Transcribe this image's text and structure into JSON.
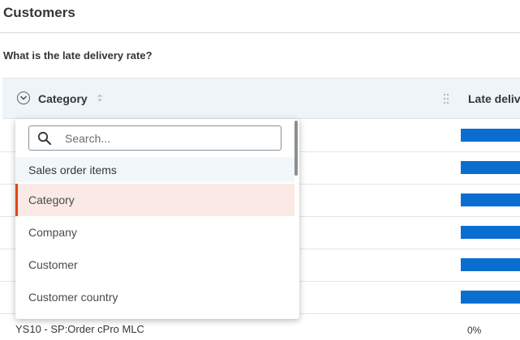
{
  "page": {
    "title": "Customers",
    "question": "What is the late delivery rate?"
  },
  "table": {
    "columns": [
      {
        "label": "Category"
      },
      {
        "label": "Late delivery rate"
      }
    ],
    "visible_row": {
      "category": "YS10 - SP:Order cPro MLC",
      "value": "0%"
    }
  },
  "dropdown": {
    "search_placeholder": "Search...",
    "group_label": "Sales order items",
    "options": [
      {
        "label": "Category",
        "selected": true
      },
      {
        "label": "Company",
        "selected": false
      },
      {
        "label": "Customer",
        "selected": false
      },
      {
        "label": "Customer country",
        "selected": false
      }
    ]
  },
  "colors": {
    "bar": "#0a6ed1",
    "selected_accent": "#e0441a",
    "selected_bg": "#fae9e4",
    "header_bg": "#eef4f8"
  },
  "icons": [
    "chevron-down-circle-icon",
    "sort-icon",
    "drag-handle-icon",
    "search-icon"
  ]
}
